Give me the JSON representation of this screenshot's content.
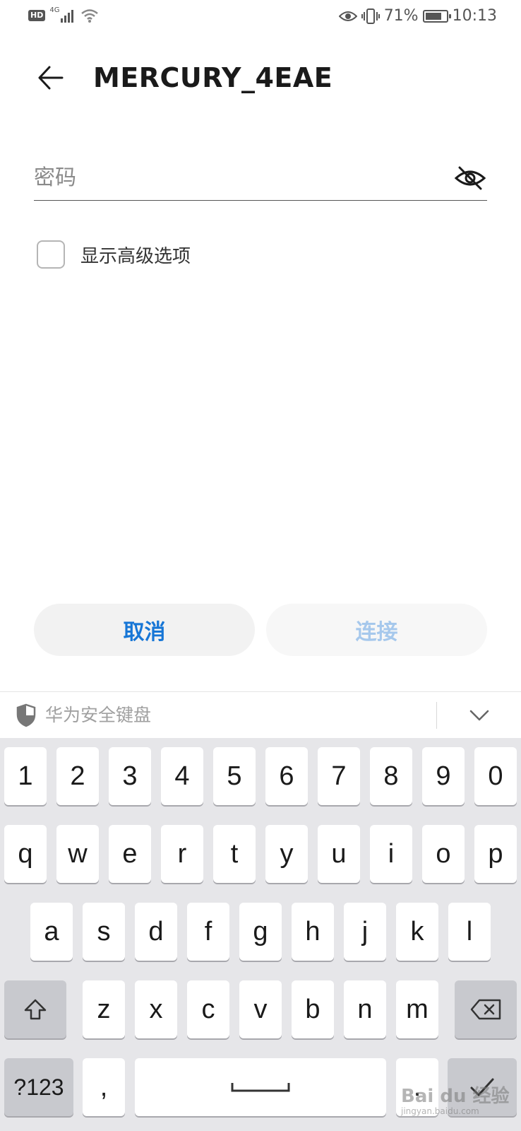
{
  "status_bar": {
    "hd": "HD",
    "network": "4G",
    "battery_percent": "71%",
    "battery_level": 0.71,
    "time": "10:13",
    "icons": [
      "hd-icon",
      "signal-icon",
      "wifi-icon",
      "eye-comfort-icon",
      "vibrate-icon",
      "battery-icon"
    ]
  },
  "header": {
    "title": "MERCURY_4EAE",
    "back_icon": "arrow-left-icon"
  },
  "password_field": {
    "placeholder": "密码",
    "value": "",
    "toggle_icon": "eye-off-icon"
  },
  "advanced_option": {
    "label": "显示高级选项",
    "checked": false
  },
  "buttons": {
    "cancel": "取消",
    "connect": "连接"
  },
  "keyboard_header": {
    "title": "华为安全键盘",
    "shield_icon": "shield-icon",
    "collapse_icon": "chevron-down-icon"
  },
  "keyboard": {
    "row_numbers": [
      "1",
      "2",
      "3",
      "4",
      "5",
      "6",
      "7",
      "8",
      "9",
      "0"
    ],
    "row_q": [
      "q",
      "w",
      "e",
      "r",
      "t",
      "y",
      "u",
      "i",
      "o",
      "p"
    ],
    "row_a": [
      "a",
      "s",
      "d",
      "f",
      "g",
      "h",
      "j",
      "k",
      "l"
    ],
    "row_z": [
      "z",
      "x",
      "c",
      "v",
      "b",
      "n",
      "m"
    ],
    "symbols_key": "?123",
    "comma_key": ",",
    "period_key": ".",
    "shift_icon": "shift-icon",
    "backspace_icon": "backspace-icon",
    "space_icon": "space-bar-icon",
    "enter_icon": "checkmark-icon"
  },
  "watermark": {
    "text": "Bai du 经验",
    "sub": "jingyan.baidu.com"
  },
  "colors": {
    "accent": "#1776d6",
    "accent_disabled": "#a6c8ec",
    "keyboard_bg": "#e6e6e9",
    "function_key": "#c8c9ce"
  }
}
